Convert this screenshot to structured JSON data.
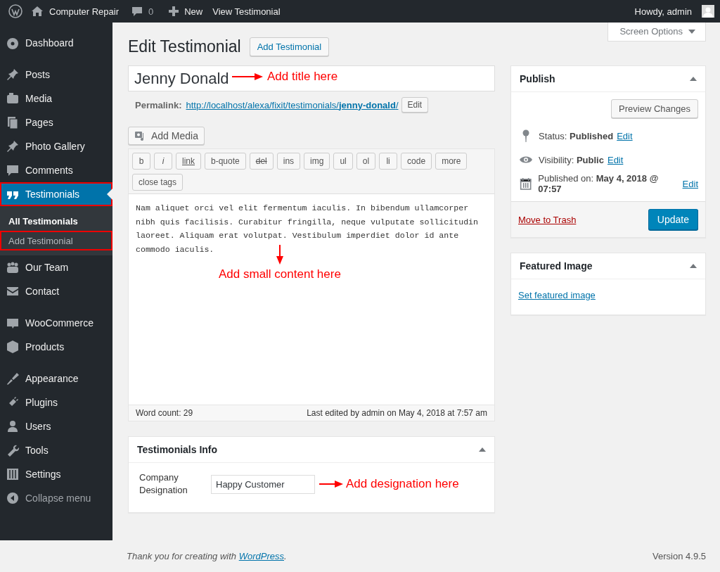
{
  "admin_bar": {
    "site_name": "Computer Repair",
    "comments": "0",
    "new_label": "New",
    "view_link": "View Testimonial",
    "greeting": "Howdy, admin"
  },
  "sidebar": {
    "groups": [
      [
        {
          "label": "Dashboard",
          "selected": false,
          "highlighted": false
        }
      ],
      [
        {
          "label": "Posts",
          "selected": false,
          "highlighted": false
        },
        {
          "label": "Media",
          "selected": false,
          "highlighted": false
        },
        {
          "label": "Pages",
          "selected": false,
          "highlighted": false
        },
        {
          "label": "Photo Gallery",
          "selected": false,
          "highlighted": false
        },
        {
          "label": "Comments",
          "selected": false,
          "highlighted": false
        },
        {
          "label": "Testimonials",
          "selected": true,
          "highlighted": true,
          "children": [
            {
              "label": "All Testimonials",
              "selected": true,
              "highlighted": false
            },
            {
              "label": "Add Testimonial",
              "selected": false,
              "highlighted": true
            }
          ]
        },
        {
          "label": "Our Team",
          "selected": false,
          "highlighted": false
        },
        {
          "label": "Contact",
          "selected": false,
          "highlighted": false
        }
      ],
      [
        {
          "label": "WooCommerce",
          "selected": false,
          "highlighted": false
        },
        {
          "label": "Products",
          "selected": false,
          "highlighted": false
        }
      ],
      [
        {
          "label": "Appearance",
          "selected": false,
          "highlighted": false
        },
        {
          "label": "Plugins",
          "selected": false,
          "highlighted": false
        },
        {
          "label": "Users",
          "selected": false,
          "highlighted": false
        },
        {
          "label": "Tools",
          "selected": false,
          "highlighted": false
        },
        {
          "label": "Settings",
          "selected": false,
          "highlighted": false
        },
        {
          "label": "Collapse menu",
          "selected": false,
          "highlighted": false
        }
      ]
    ]
  },
  "screen_options": {
    "label": "Screen Options",
    "expanded": false
  },
  "page": {
    "title": "Edit Testimonial",
    "add_button": "Add Testimonial"
  },
  "title_field": {
    "value": "Jenny Donald",
    "annotation": "Add title here"
  },
  "permalink": {
    "label": "Permalink:",
    "url": "http://localhost/alexa/fixit/testimonials/**jenny-donald**/",
    "edit": "Edit"
  },
  "add_media": "Add Media",
  "editor": {
    "buttons": [
      {
        "label": "b",
        "kind": "plain"
      },
      {
        "label": "i",
        "kind": "italic"
      },
      {
        "label": "link",
        "kind": "underline"
      },
      {
        "label": "b-quote",
        "kind": "plain"
      },
      {
        "label": "del",
        "kind": "strike"
      },
      {
        "label": "ins",
        "kind": "plain"
      },
      {
        "label": "img",
        "kind": "plain"
      },
      {
        "label": "ul",
        "kind": "plain"
      },
      {
        "label": "ol",
        "kind": "plain"
      },
      {
        "label": "li",
        "kind": "plain"
      },
      {
        "label": "code",
        "kind": "plain"
      },
      {
        "label": "more",
        "kind": "plain"
      },
      {
        "label": "close tags",
        "kind": "plain"
      }
    ],
    "content": "Nam aliquet orci vel elit fermentum iaculis. In bibendum ullamcorper nibh quis facilisis. Curabitur fringilla, neque vulputate sollicitudin laoreet. Aliquam erat volutpat. Vestibulum imperdiet dolor id ante commodo iaculis.",
    "annotation": "Add small content here",
    "word_count": "Word count: 29",
    "last_edited": "Last edited by admin on May 4, 2018 at 7:57 am"
  },
  "testimonials_info": {
    "title": "Testimonials Info",
    "expanded": true,
    "field_label": "Company Designation",
    "field_value": "Happy Customer",
    "annotation": "Add designation here"
  },
  "publish": {
    "title": "Publish",
    "expanded": true,
    "preview": "Preview Changes",
    "rows": [
      {
        "text": "Status: **Published**",
        "link": "Edit"
      },
      {
        "text": "Visibility: **Public**",
        "link": "Edit"
      },
      {
        "text": "Published on: **May 4, 2018 @ 07:57**",
        "link": "Edit"
      }
    ],
    "trash": "Move to Trash",
    "update": "Update"
  },
  "featured_image": {
    "title": "Featured Image",
    "expanded": true,
    "link": "Set featured image"
  },
  "footer": {
    "text": "Thank you for creating with ",
    "link": "WordPress",
    "after": ".",
    "version": "Version 4.9.5"
  }
}
